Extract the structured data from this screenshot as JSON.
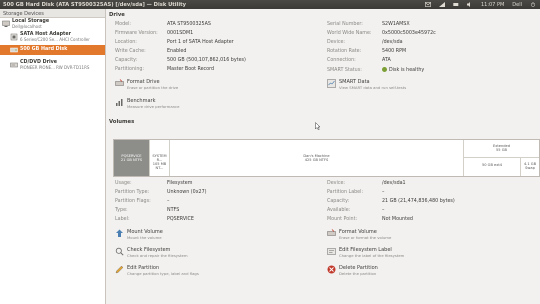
{
  "window": {
    "title": "500 GB Hard Disk (ATA ST9500325AS) [/dev/sda] — Disk Utility",
    "time": "11:07 PM",
    "user": "Dell"
  },
  "sidebar": {
    "header": "Storage Devices",
    "items": [
      {
        "title": "Local Storage",
        "subtitle": "Dell@localhost"
      },
      {
        "title": "SATA Host Adapter",
        "subtitle": "6 Series/C200 Se... AHCI Controller"
      },
      {
        "title": "500 GB Hard Disk",
        "subtitle": ""
      },
      {
        "title": "CD/DVD Drive",
        "subtitle": "PIONEER PIONE... RW DVR-TD11RS"
      }
    ]
  },
  "drive": {
    "section": "Drive",
    "left": [
      {
        "k": "Model:",
        "v": "ATA ST9500325AS"
      },
      {
        "k": "Firmware Version:",
        "v": "0001SDM1"
      },
      {
        "k": "Location:",
        "v": "Port 1 of SATA Host Adapter"
      },
      {
        "k": "Write Cache:",
        "v": "Enabled"
      },
      {
        "k": "Capacity:",
        "v": "500 GB (500,107,862,016 bytes)"
      },
      {
        "k": "Partitioning:",
        "v": "Master Boot Record"
      }
    ],
    "right": [
      {
        "k": "Serial Number:",
        "v": "S2W1AMSX"
      },
      {
        "k": "World Wide Name:",
        "v": "0x5000c5003e45972c"
      },
      {
        "k": "Device:",
        "v": "/dev/sda"
      },
      {
        "k": "Rotation Rate:",
        "v": "5400 RPM"
      },
      {
        "k": "Connection:",
        "v": "ATA"
      },
      {
        "k": "SMART Status:",
        "v": "Disk is healthy"
      }
    ],
    "actions": [
      {
        "title": "Format Drive",
        "desc": "Erase or partition the drive"
      },
      {
        "title": "SMART Data",
        "desc": "View SMART data and run self-tests"
      },
      {
        "title": "Benchmark",
        "desc": "Measure drive performance"
      }
    ]
  },
  "volumes": {
    "section": "Volumes",
    "segments": [
      {
        "t1": "PQSERVICE",
        "t2": "21 GB NTFS"
      },
      {
        "t1": "SYSTEM R...",
        "t2": "105 MB NT..."
      },
      {
        "t1": "Dan's Machine",
        "t2": "425 GB NTFS"
      },
      {
        "t1": "Extended",
        "t2": "55 GB"
      },
      {
        "t1": "50 GB ext4",
        "t2": ""
      },
      {
        "t1": "4.1 GB",
        "t2": "Swap"
      }
    ]
  },
  "volume_info": {
    "left": [
      {
        "k": "Usage:",
        "v": "Filesystem"
      },
      {
        "k": "Partition Type:",
        "v": "Unknown (0x27)"
      },
      {
        "k": "Partition Flags:",
        "v": "–"
      },
      {
        "k": "Type:",
        "v": "NTFS"
      },
      {
        "k": "Label:",
        "v": "PQSERVICE"
      }
    ],
    "right": [
      {
        "k": "Device:",
        "v": "/dev/sda1"
      },
      {
        "k": "Partition Label:",
        "v": "–"
      },
      {
        "k": "Capacity:",
        "v": "21 GB (21,474,836,480 bytes)"
      },
      {
        "k": "Available:",
        "v": "–"
      },
      {
        "k": "Mount Point:",
        "v": "Not Mounted"
      }
    ],
    "actions": [
      {
        "title": "Mount Volume",
        "desc": "Mount the volume"
      },
      {
        "title": "Format Volume",
        "desc": "Erase or format the volume"
      },
      {
        "title": "Check Filesystem",
        "desc": "Check and repair the filesystem"
      },
      {
        "title": "Edit Filesystem Label",
        "desc": "Change the label of the filesystem"
      },
      {
        "title": "Edit Partition",
        "desc": "Change partition type, label and flags"
      },
      {
        "title": "Delete Partition",
        "desc": "Delete the partition"
      }
    ]
  },
  "colors": {
    "selection": "#e2782c",
    "panel": "#3b3a36",
    "healthy": "#7b9f35"
  }
}
